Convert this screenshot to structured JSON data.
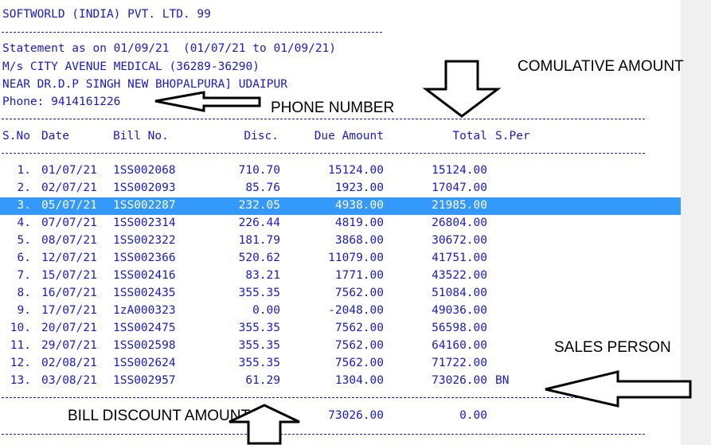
{
  "header": {
    "company": "SOFTWORLD (INDIA) PVT. LTD. 99",
    "statement": "Statement as on 01/09/21  (01/07/21 to 01/09/21)",
    "party": "M/s CITY AVENUE MEDICAL (36289-36290)",
    "address": "NEAR DR.D.P SINGH NEW BHOPALPURA] UDAIPUR",
    "phone": "Phone: 9414161226"
  },
  "columns": {
    "sno": "S.No",
    "date": "Date",
    "bill": "Bill No.",
    "disc": "Disc.",
    "due": "Due Amount",
    "total": "Total",
    "sper": "S.Per"
  },
  "rows": [
    {
      "sno": "1.",
      "date": "01/07/21",
      "bill": "1SS002068",
      "disc": "710.70",
      "due": "15124.00",
      "total": "15124.00",
      "sper": ""
    },
    {
      "sno": "2.",
      "date": "02/07/21",
      "bill": "1SS002093",
      "disc": "85.76",
      "due": "1923.00",
      "total": "17047.00",
      "sper": ""
    },
    {
      "sno": "3.",
      "date": "05/07/21",
      "bill": "1SS002287",
      "disc": "232.05",
      "due": "4938.00",
      "total": "21985.00",
      "sper": ""
    },
    {
      "sno": "4.",
      "date": "07/07/21",
      "bill": "1SS002314",
      "disc": "226.44",
      "due": "4819.00",
      "total": "26804.00",
      "sper": ""
    },
    {
      "sno": "5.",
      "date": "08/07/21",
      "bill": "1SS002322",
      "disc": "181.79",
      "due": "3868.00",
      "total": "30672.00",
      "sper": ""
    },
    {
      "sno": "6.",
      "date": "12/07/21",
      "bill": "1SS002366",
      "disc": "520.62",
      "due": "11079.00",
      "total": "41751.00",
      "sper": ""
    },
    {
      "sno": "7.",
      "date": "15/07/21",
      "bill": "1SS002416",
      "disc": "83.21",
      "due": "1771.00",
      "total": "43522.00",
      "sper": ""
    },
    {
      "sno": "8.",
      "date": "16/07/21",
      "bill": "1SS002435",
      "disc": "355.35",
      "due": "7562.00",
      "total": "51084.00",
      "sper": ""
    },
    {
      "sno": "9.",
      "date": "17/07/21",
      "bill": "1zA000323",
      "disc": "0.00",
      "due": "-2048.00",
      "total": "49036.00",
      "sper": ""
    },
    {
      "sno": "10.",
      "date": "20/07/21",
      "bill": "1SS002475",
      "disc": "355.35",
      "due": "7562.00",
      "total": "56598.00",
      "sper": ""
    },
    {
      "sno": "11.",
      "date": "29/07/21",
      "bill": "1SS002598",
      "disc": "355.35",
      "due": "7562.00",
      "total": "64160.00",
      "sper": ""
    },
    {
      "sno": "12.",
      "date": "02/08/21",
      "bill": "1SS002624",
      "disc": "355.35",
      "due": "7562.00",
      "total": "71722.00",
      "sper": ""
    },
    {
      "sno": "13.",
      "date": "03/08/21",
      "bill": "1SS002957",
      "disc": "61.29",
      "due": "1304.00",
      "total": "73026.00",
      "sper": "BN"
    }
  ],
  "selected_row": "3.",
  "footer": {
    "due_total": "73026.00",
    "total": "0.00"
  },
  "annotations": {
    "cumulative": "COMULATIVE AMOUNT",
    "phone": "PHONE NUMBER",
    "sales": "SALES PERSON",
    "bill_discount": "BILL DISCOUNT AMOUNT"
  },
  "colors": {
    "text": "#1a1acd",
    "selection": "#3399ff",
    "strip": "#f0f0f0"
  }
}
